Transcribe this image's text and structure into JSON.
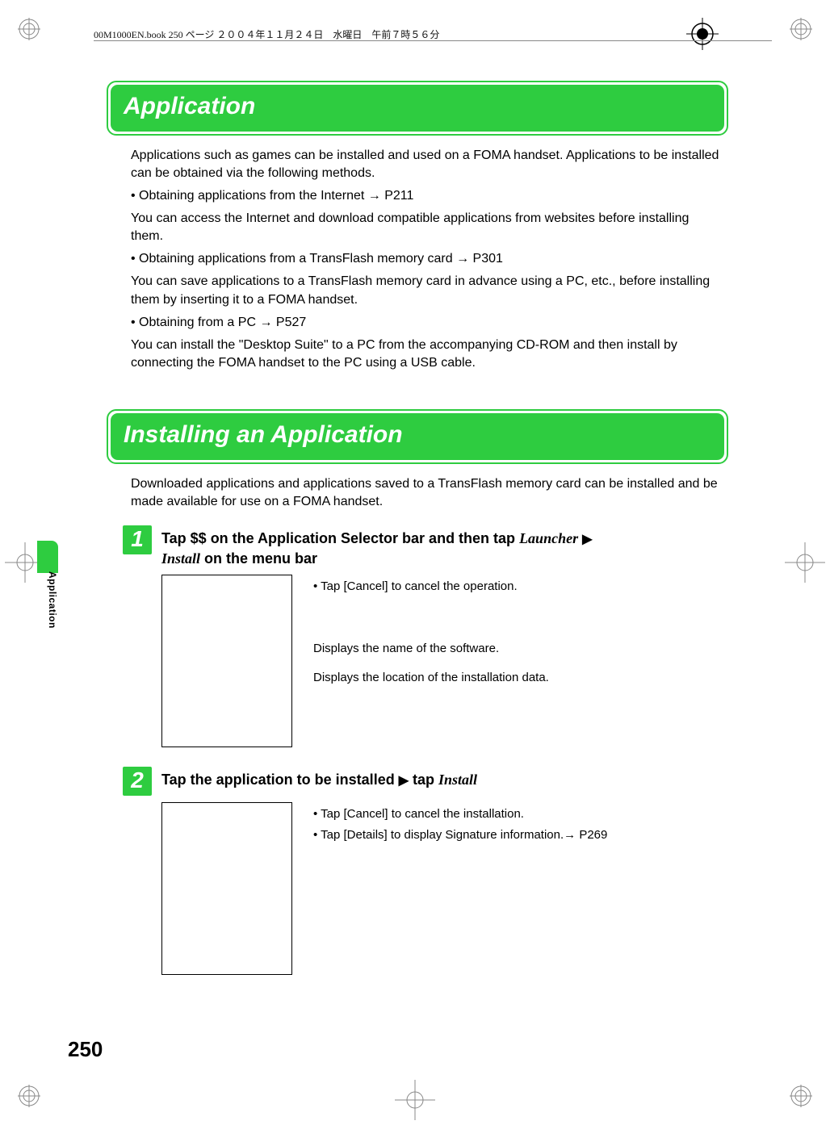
{
  "header_line": "00M1000EN.book  250 ページ  ２００４年１１月２４日　水曜日　午前７時５６分",
  "sections": {
    "application": {
      "title": "Application",
      "intro": "Applications such as games can be installed and used on a FOMA handset. Applications to be installed can be obtained via the following methods.",
      "bullet1": "Obtaining applications from the Internet → P211",
      "para1": "You can access the Internet and download compatible applications from websites before installing them.",
      "bullet2": "Obtaining applications from a TransFlash memory card → P301",
      "para2": "You can save applications to a TransFlash memory card in advance using a PC, etc., before installing them by inserting it to a FOMA handset.",
      "bullet3": "Obtaining from a PC → P527",
      "para3": "You can install the \"Desktop Suite\" to a PC from the accompanying CD-ROM and then install by connecting the FOMA handset to the PC using a USB cable."
    },
    "installing": {
      "title": "Installing an Application",
      "intro": "Downloaded applications and applications saved to a TransFlash memory card can be installed and be made available for use on a FOMA handset.",
      "step1": {
        "num": "1",
        "head_pre": "Tap $$ on the Application Selector bar and then tap ",
        "head_ital1": "Launcher",
        "head_mid": " ",
        "head_ital2": "Install",
        "head_post": " on the menu bar",
        "note1": "Tap [Cancel] to cancel the operation.",
        "desc1": "Displays the name of the software.",
        "desc2": "Displays the location of the installation data."
      },
      "step2": {
        "num": "2",
        "head_pre": "Tap the application to be installed ",
        "head_mid": " tap ",
        "head_ital": "Install",
        "note1": "Tap [Cancel] to cancel the installation.",
        "note2": "Tap [Details] to display Signature information.→ P269"
      }
    }
  },
  "side_tab": "Application",
  "page_number": "250"
}
